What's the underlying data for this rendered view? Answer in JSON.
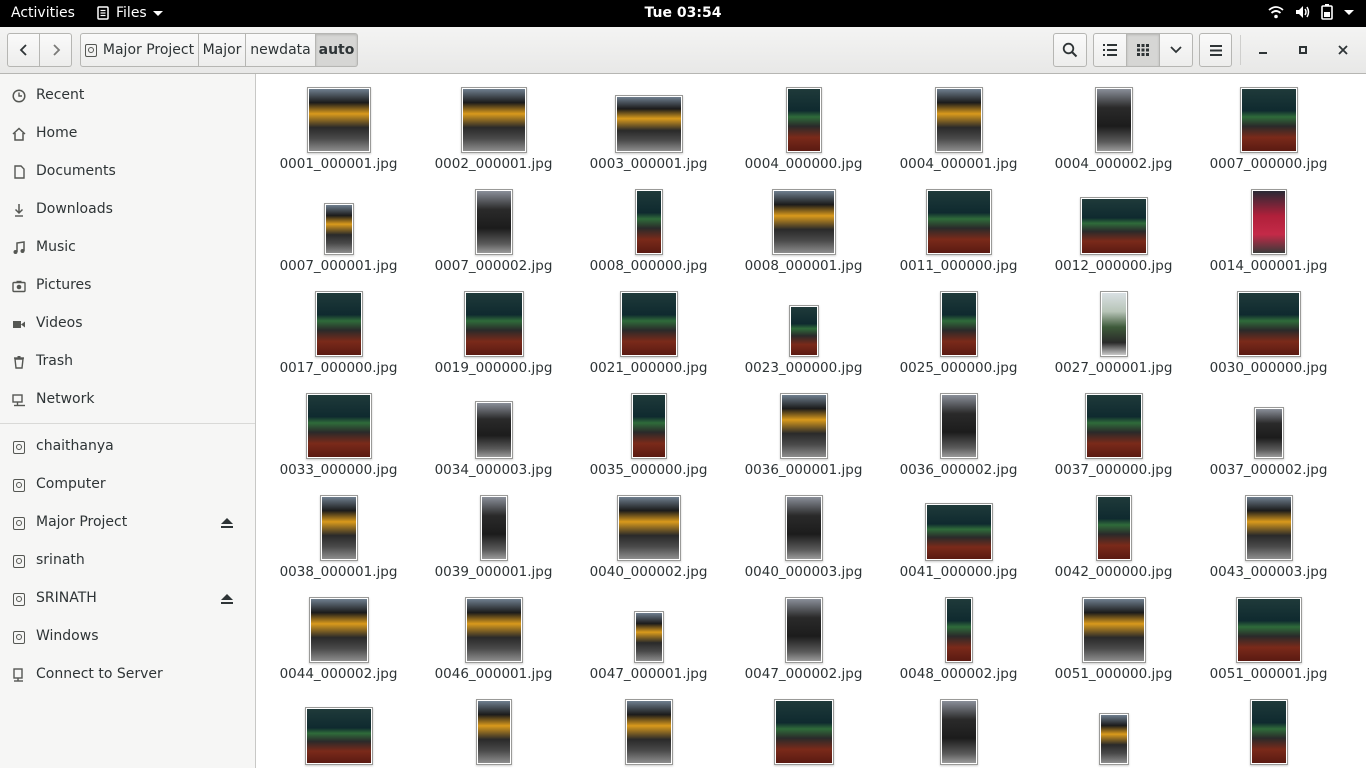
{
  "topbar": {
    "activities": "Activities",
    "app_name": "Files",
    "clock": "Tue 03:54"
  },
  "headerbar": {
    "breadcrumbs": [
      {
        "label": "Major Project"
      },
      {
        "label": "Major"
      },
      {
        "label": "newdata"
      },
      {
        "label": "auto"
      }
    ]
  },
  "sidebar": {
    "places": [
      {
        "label": "Recent",
        "icon": "clock-icon"
      },
      {
        "label": "Home",
        "icon": "home-icon"
      },
      {
        "label": "Documents",
        "icon": "document-icon"
      },
      {
        "label": "Downloads",
        "icon": "download-icon"
      },
      {
        "label": "Music",
        "icon": "music-icon"
      },
      {
        "label": "Pictures",
        "icon": "camera-icon"
      },
      {
        "label": "Videos",
        "icon": "video-icon"
      },
      {
        "label": "Trash",
        "icon": "trash-icon"
      },
      {
        "label": "Network",
        "icon": "network-icon"
      }
    ],
    "devices": [
      {
        "label": "chaithanya",
        "eject": false
      },
      {
        "label": "Computer",
        "eject": false
      },
      {
        "label": "Major Project",
        "eject": true
      },
      {
        "label": "srinath",
        "eject": false
      },
      {
        "label": "SRINATH",
        "eject": true
      },
      {
        "label": "Windows",
        "eject": false
      }
    ],
    "connect": "Connect to Server"
  },
  "files": [
    {
      "name": "0001_000001.jpg",
      "tone": "yellow"
    },
    {
      "name": "0002_000001.jpg",
      "tone": "yellow"
    },
    {
      "name": "0003_000001.jpg",
      "tone": "yellow"
    },
    {
      "name": "0004_000000.jpg",
      "tone": "green"
    },
    {
      "name": "0004_000001.jpg",
      "tone": "yellow"
    },
    {
      "name": "0004_000002.jpg",
      "tone": "dark"
    },
    {
      "name": "0007_000000.jpg",
      "tone": "green"
    },
    {
      "name": "0007_000001.jpg",
      "tone": "yellow"
    },
    {
      "name": "0007_000002.jpg",
      "tone": "dark"
    },
    {
      "name": "0008_000000.jpg",
      "tone": "green"
    },
    {
      "name": "0008_000001.jpg",
      "tone": "yellow"
    },
    {
      "name": "0011_000000.jpg",
      "tone": "green"
    },
    {
      "name": "0012_000000.jpg",
      "tone": "green"
    },
    {
      "name": "0014_000001.jpg",
      "tone": "red"
    },
    {
      "name": "0017_000000.jpg",
      "tone": "green"
    },
    {
      "name": "0019_000000.jpg",
      "tone": "green"
    },
    {
      "name": "0021_000000.jpg",
      "tone": "green"
    },
    {
      "name": "0023_000000.jpg",
      "tone": "green"
    },
    {
      "name": "0025_000000.jpg",
      "tone": "green"
    },
    {
      "name": "0027_000001.jpg",
      "tone": "light"
    },
    {
      "name": "0030_000000.jpg",
      "tone": "green"
    },
    {
      "name": "0033_000000.jpg",
      "tone": "green"
    },
    {
      "name": "0034_000003.jpg",
      "tone": "dark"
    },
    {
      "name": "0035_000000.jpg",
      "tone": "green"
    },
    {
      "name": "0036_000001.jpg",
      "tone": "yellow"
    },
    {
      "name": "0036_000002.jpg",
      "tone": "dark"
    },
    {
      "name": "0037_000000.jpg",
      "tone": "green"
    },
    {
      "name": "0037_000002.jpg",
      "tone": "dark"
    },
    {
      "name": "0038_000001.jpg",
      "tone": "yellow"
    },
    {
      "name": "0039_000001.jpg",
      "tone": "dark"
    },
    {
      "name": "0040_000002.jpg",
      "tone": "yellow"
    },
    {
      "name": "0040_000003.jpg",
      "tone": "dark"
    },
    {
      "name": "0041_000000.jpg",
      "tone": "green"
    },
    {
      "name": "0042_000000.jpg",
      "tone": "green"
    },
    {
      "name": "0043_000003.jpg",
      "tone": "yellow"
    },
    {
      "name": "0044_000002.jpg",
      "tone": "yellow"
    },
    {
      "name": "0046_000001.jpg",
      "tone": "yellow"
    },
    {
      "name": "0047_000001.jpg",
      "tone": "yellow"
    },
    {
      "name": "0047_000002.jpg",
      "tone": "dark"
    },
    {
      "name": "0048_000002.jpg",
      "tone": "green"
    },
    {
      "name": "0051_000000.jpg",
      "tone": "yellow"
    },
    {
      "name": "0051_000001.jpg",
      "tone": "green"
    },
    {
      "name": "",
      "tone": "green"
    },
    {
      "name": "",
      "tone": "yellow"
    },
    {
      "name": "",
      "tone": "yellow"
    },
    {
      "name": "",
      "tone": "green"
    },
    {
      "name": "",
      "tone": "dark"
    },
    {
      "name": "",
      "tone": "yellow"
    },
    {
      "name": "",
      "tone": "green"
    }
  ],
  "colors": {
    "topbar_bg": "#000000",
    "sidebar_bg": "#f6f6f5",
    "accent_text": "#2e3436"
  }
}
